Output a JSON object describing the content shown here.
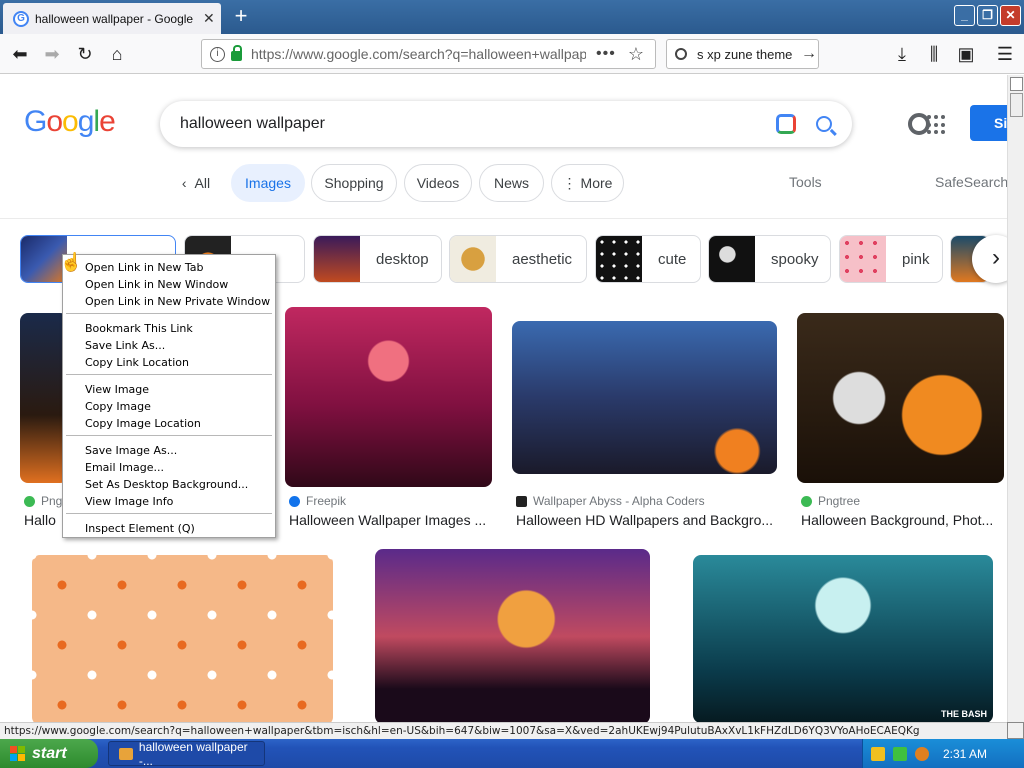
{
  "browser": {
    "tab_title": "halloween wallpaper - Google Search",
    "url": "https://www.google.com/search?q=halloween+wallpaper",
    "search_text": "s xp zune theme"
  },
  "google": {
    "logo": "Google",
    "query": "halloween wallpaper",
    "signin_label": "Si"
  },
  "filters": [
    "All",
    "Images",
    "Shopping",
    "Videos",
    "News",
    "More"
  ],
  "filters_active": "Images",
  "tools_label": "Tools",
  "safesearch_label": "SafeSearch",
  "suggestions": [
    "",
    "me",
    "desktop",
    "aesthetic",
    "cute",
    "spooky",
    "pink"
  ],
  "results": [
    {
      "source": "Pngt",
      "title": "Hallo"
    },
    {
      "source": "Freepik",
      "title": "Halloween Wallpaper Images ..."
    },
    {
      "source": "Wallpaper Abyss - Alpha Coders",
      "title": "Halloween HD Wallpapers and Backgro..."
    },
    {
      "source": "Pngtree",
      "title": "Halloween Background, Phot..."
    }
  ],
  "watermark": "THE BASH",
  "context_menu": {
    "groups": [
      [
        "Open Link in New Tab",
        "Open Link in New Window",
        "Open Link in New Private Window"
      ],
      [
        "Bookmark This Link",
        "Save Link As...",
        "Copy Link Location"
      ],
      [
        "View Image",
        "Copy Image",
        "Copy Image Location"
      ],
      [
        "Save Image As...",
        "Email Image...",
        "Set As Desktop Background...",
        "View Image Info"
      ],
      [
        "Inspect Element (Q)"
      ]
    ]
  },
  "status_url": "https://www.google.com/search?q=halloween+wallpaper&tbm=isch&hl=en-US&bih=647&biw=1007&sa=X&ved=2ahUKEwj94PulutuBAxXvL1kFHZdLD6YQ3VYoAHoECAEQKg",
  "taskbar": {
    "start": "start",
    "task": "halloween wallpaper -...",
    "time": "2:31 AM"
  }
}
